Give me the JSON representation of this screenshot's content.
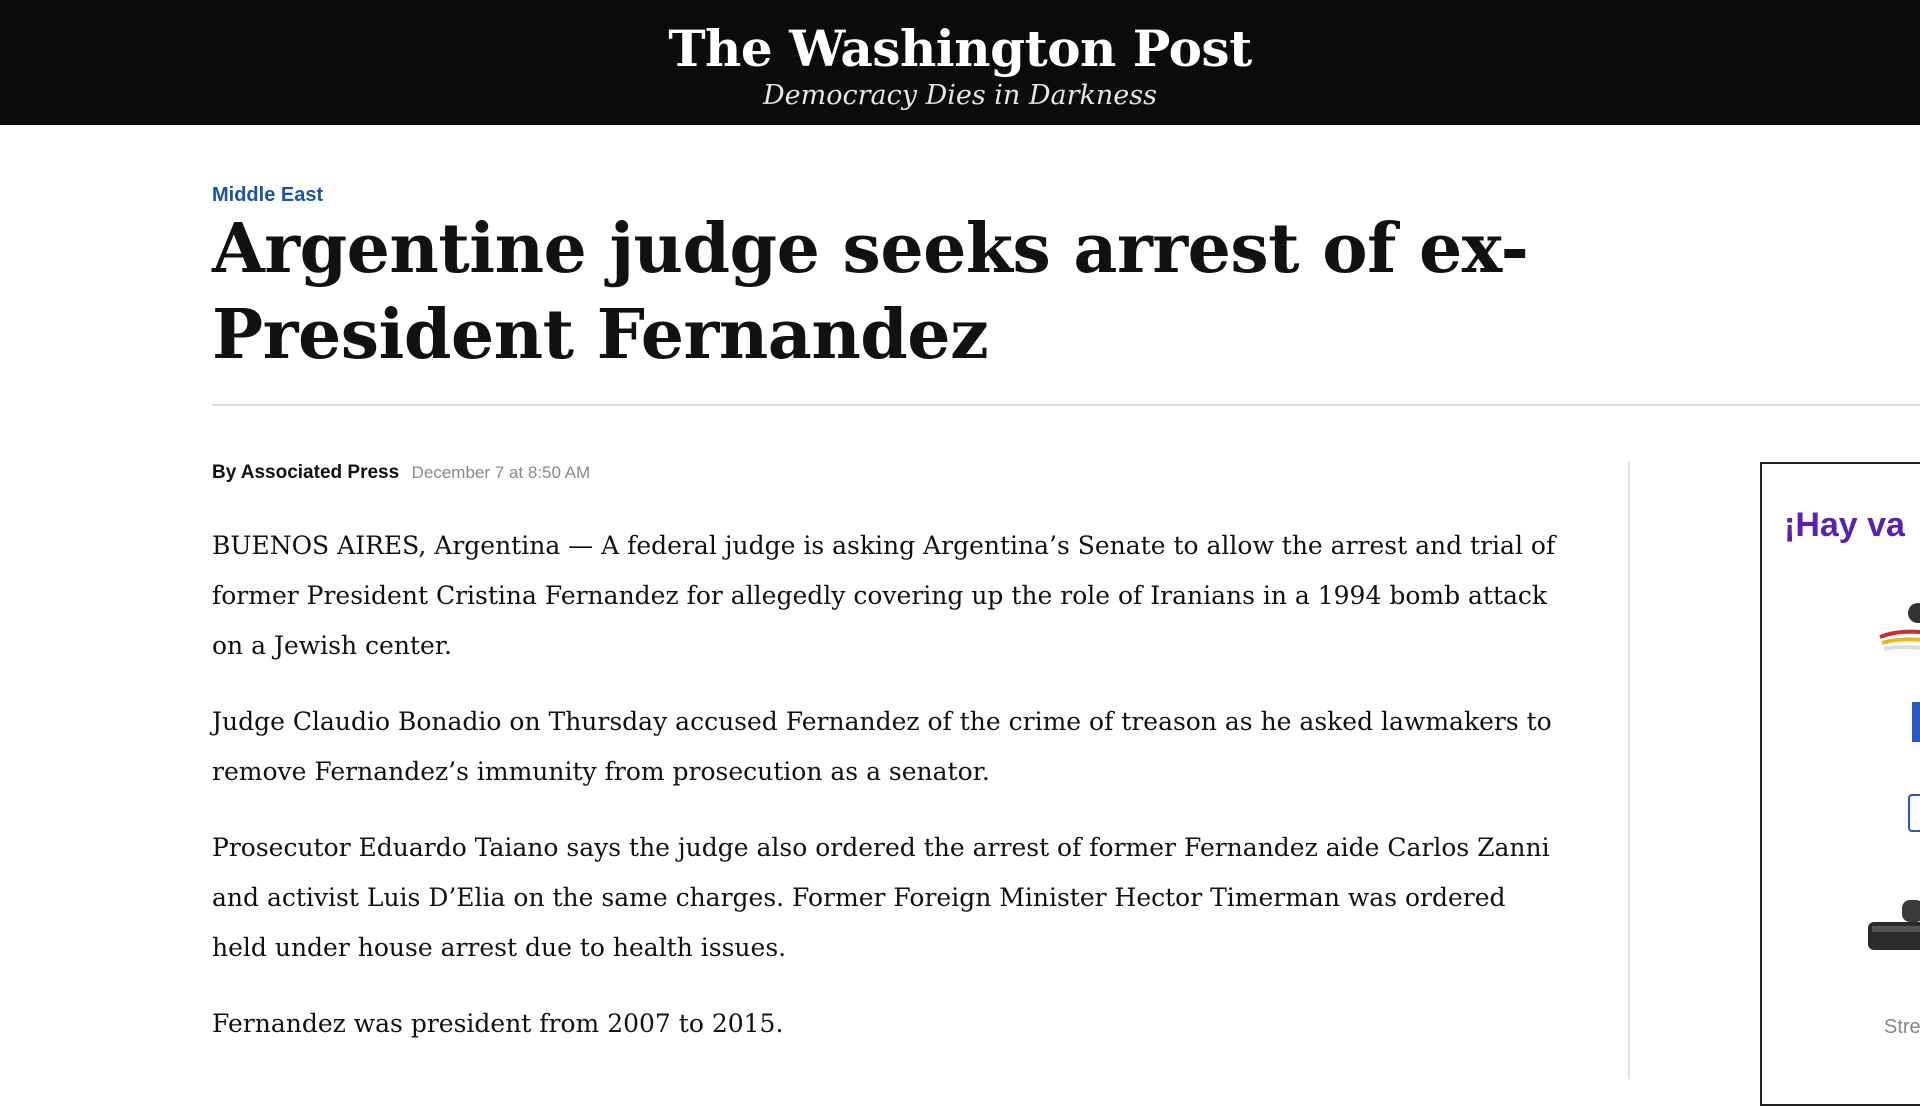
{
  "masthead": {
    "logo": "The Washington Post",
    "tagline": "Democracy Dies in Darkness"
  },
  "article": {
    "kicker": "Middle East",
    "headline": "Argentine judge seeks arrest of ex-President Fernandez",
    "byline_prefix": "By",
    "author": "Associated Press",
    "timestamp": "December 7 at 8:50 AM",
    "paragraphs": [
      "BUENOS AIRES, Argentina — A federal judge is asking Argentina’s Senate to allow the arrest and trial of former President Cristina Fernandez for allegedly covering up the role of Iranians in a 1994 bomb attack on a Jewish center.",
      "Judge Claudio Bonadio on Thursday accused Fernandez of the crime of treason as he asked lawmakers to remove Fernandez’s immunity from prosecution as a senator.",
      "Prosecutor Eduardo Taiano says the judge also ordered the arrest of former Fernandez aide Carlos Zanni and activist Luis D’Elia on the same charges. Former Foreign Minister Hector Timerman was ordered held under house arrest due to health issues.",
      "Fernandez was president from 2007 to 2015."
    ]
  },
  "ad": {
    "headline": "¡Hay va",
    "caption": "Stre",
    "accent_color": "#5a1fb5",
    "icons": [
      "cable-icon",
      "streaming-device-icon"
    ]
  },
  "colors": {
    "masthead_bg": "#0b0b0b",
    "kicker": "#1955a5",
    "text": "#111111",
    "timestamp": "#8a8a8a"
  }
}
